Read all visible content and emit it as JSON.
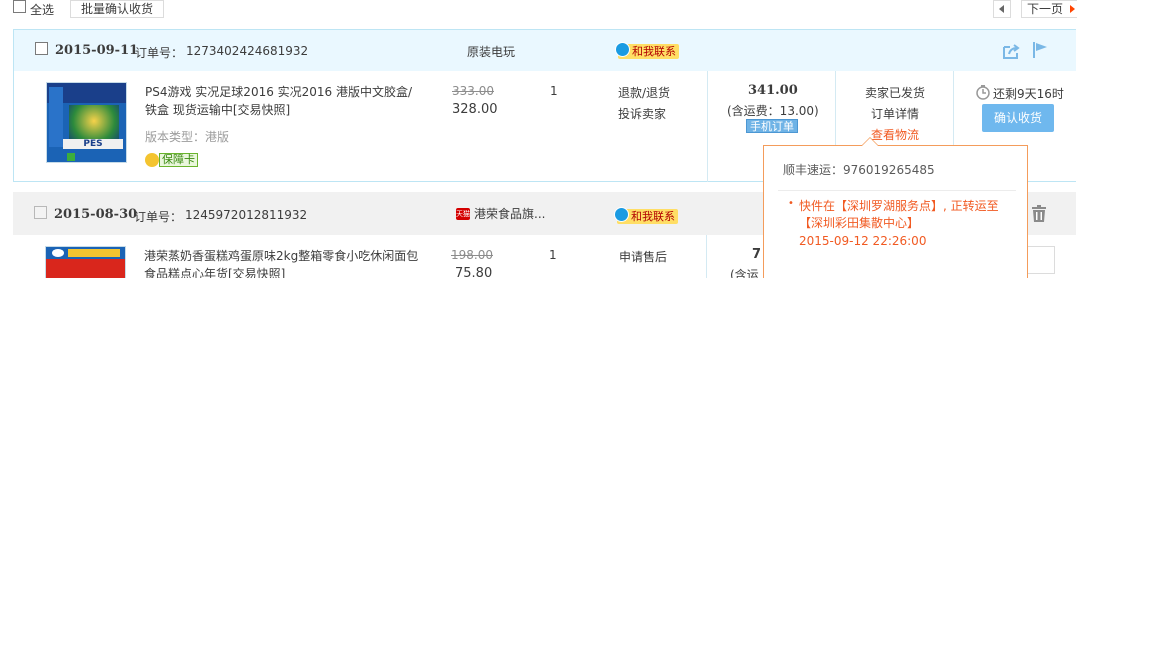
{
  "toolbar": {
    "select_all": "全选",
    "batch_confirm": "批量确认收货",
    "next_page": "下一页"
  },
  "orders": [
    {
      "date": "2015-09-11",
      "order_no_label": "订单号：",
      "order_no": "1273402424681932",
      "shop": "原装电玩",
      "contact": "和我联系",
      "item": {
        "title": "PS4游戏 实况足球2016 实况2016 港版中文胶盒/铁盒 现货运输中[交易快照]",
        "variant": "版本类型：港版",
        "guarantee": "保障卡",
        "original_price": "333.00",
        "price": "328.00",
        "quantity": "1",
        "after_sale_1": "退款/退货",
        "after_sale_2": "投诉卖家",
        "total": "341.00",
        "shipping": "(含运费：13.00)",
        "mobile_order": "手机订单",
        "status": "卖家已发货",
        "detail": "订单详情",
        "logistics": "查看物流",
        "remaining": "还剩9天16时",
        "confirm": "确认收货"
      }
    },
    {
      "date": "2015-08-30",
      "order_no_label": "订单号：",
      "order_no": "1245972012811932",
      "shop_badge": "天猫",
      "shop": "港荣食品旗...",
      "contact": "和我联系",
      "item": {
        "title": "港荣蒸奶香蛋糕鸡蛋原味2kg整箱零食小吃休闲面包食品糕点心年货[交易快照]",
        "original_price": "198.00",
        "price": "75.80",
        "quantity": "1",
        "after_sale_1": "申请售后",
        "total_partial": "7",
        "shipping_partial": "(含运"
      }
    }
  ],
  "tracking_popup": {
    "carrier": "顺丰速运：976019265485",
    "event": "快件在【深圳罗湖服务点】, 正转运至【深圳彩田集散中心】",
    "time": "2015-09-12 22:26:00"
  },
  "colors": {
    "accent_orange": "#f15a22",
    "header_blue_bg": "#eaf8ff",
    "confirm_blue": "#6fb8ee"
  }
}
